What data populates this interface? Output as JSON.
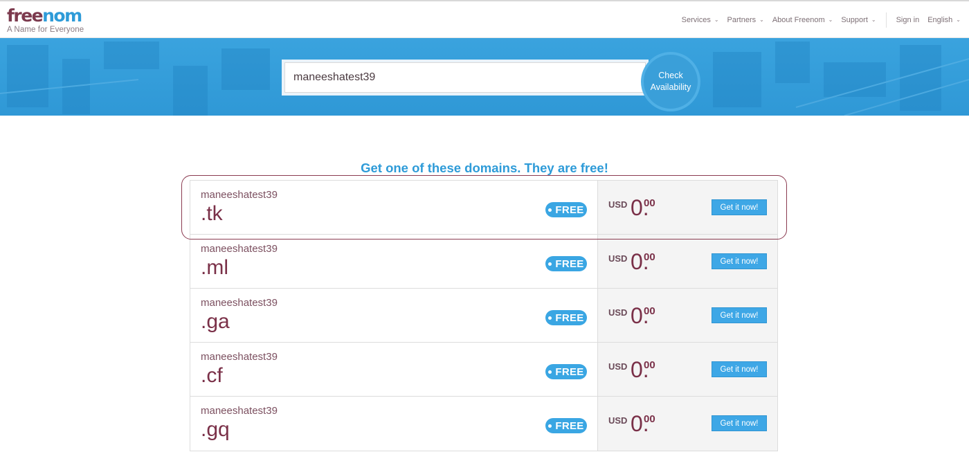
{
  "header": {
    "logo": {
      "free": "free",
      "nom": "nom",
      "tagline": "A Name for Everyone"
    },
    "nav": [
      {
        "label": "Services"
      },
      {
        "label": "Partners"
      },
      {
        "label": "About Freenom"
      },
      {
        "label": "Support"
      }
    ],
    "sign_in": "Sign in",
    "language": "English"
  },
  "banner": {
    "search_value": "maneeshatest39",
    "check_line1": "Check",
    "check_line2": "Availability"
  },
  "main": {
    "headline_pre": "Get one of these domains. They are ",
    "headline_bold": "free",
    "headline_post": "!",
    "rows": [
      {
        "name": "maneeshatest39",
        "tld": ".tk",
        "badge": "FREE",
        "currency": "USD",
        "price_main": "0.",
        "price_dec": "00",
        "button": "Get it now!"
      },
      {
        "name": "maneeshatest39",
        "tld": ".ml",
        "badge": "FREE",
        "currency": "USD",
        "price_main": "0.",
        "price_dec": "00",
        "button": "Get it now!"
      },
      {
        "name": "maneeshatest39",
        "tld": ".ga",
        "badge": "FREE",
        "currency": "USD",
        "price_main": "0.",
        "price_dec": "00",
        "button": "Get it now!"
      },
      {
        "name": "maneeshatest39",
        "tld": ".cf",
        "badge": "FREE",
        "currency": "USD",
        "price_main": "0.",
        "price_dec": "00",
        "button": "Get it now!"
      },
      {
        "name": "maneeshatest39",
        "tld": ".gq",
        "badge": "FREE",
        "currency": "USD",
        "price_main": "0.",
        "price_dec": "00",
        "button": "Get it now!"
      }
    ]
  },
  "colors": {
    "brand_blue": "#2e9bd8",
    "brand_maroon": "#7a3048",
    "highlight": "#8a3a50"
  }
}
